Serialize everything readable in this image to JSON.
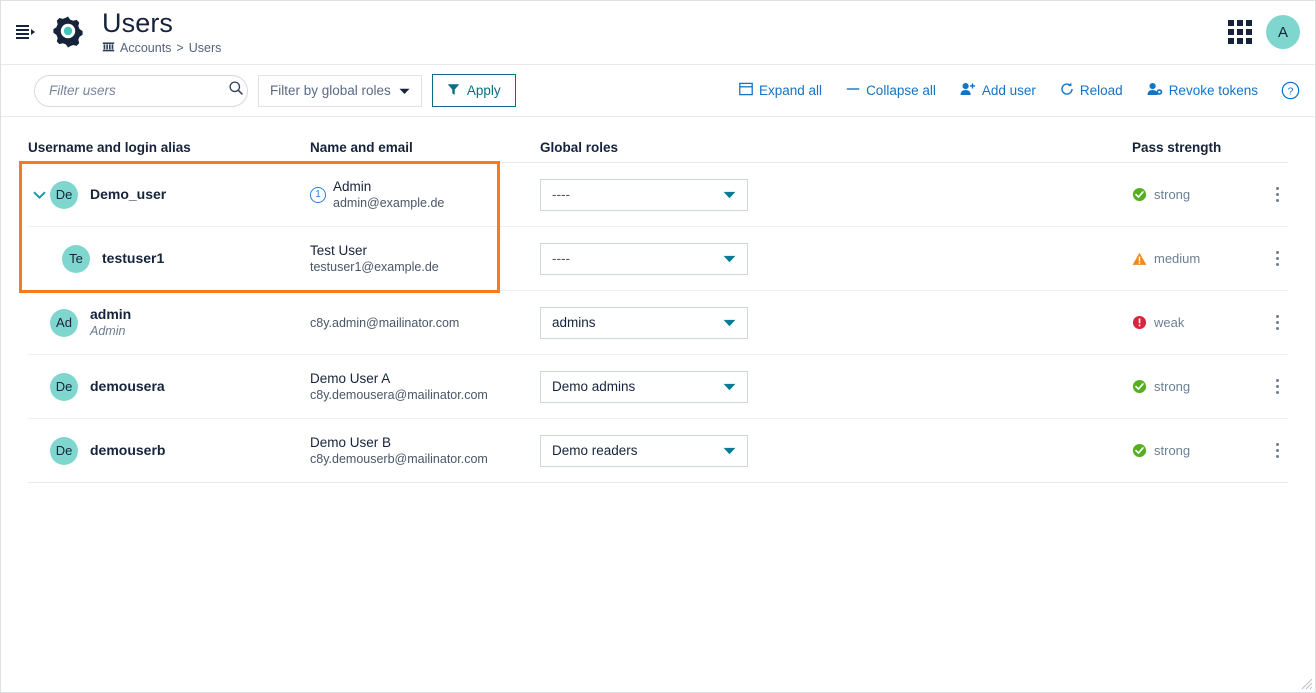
{
  "header": {
    "menu_icon": "hamburger-icon",
    "app_icon": "gear-icon",
    "title": "Users",
    "breadcrumb": {
      "icon": "bank-icon",
      "root": "Accounts",
      "separator": ">",
      "current": "Users"
    },
    "apps_icon": "app-grid-icon",
    "avatar_initial": "A"
  },
  "toolbar": {
    "search_placeholder": "Filter users",
    "search_value": "",
    "search_icon": "search-icon",
    "roles_filter_label": "Filter by global roles",
    "apply_label": "Apply",
    "actions": [
      {
        "label": "Expand all",
        "icon": "expand-all-icon"
      },
      {
        "label": "Collapse all",
        "icon": "collapse-all-icon"
      },
      {
        "label": "Add user",
        "icon": "add-user-icon"
      },
      {
        "label": "Reload",
        "icon": "reload-icon"
      },
      {
        "label": "Revoke tokens",
        "icon": "revoke-tokens-icon"
      }
    ],
    "help_icon": "help-icon"
  },
  "table": {
    "columns": [
      "Username and login alias",
      "Name and email",
      "Global roles",
      "Pass strength"
    ],
    "rows": [
      {
        "expandable": true,
        "avatar": "De",
        "username": "Demo_user",
        "alias": "",
        "badge": "1",
        "fullname": "Admin",
        "email": "admin@example.de",
        "role": "----",
        "role_empty": true,
        "pass": "strong",
        "pass_kind": "strong",
        "highlighted": true
      },
      {
        "expandable": false,
        "indented": true,
        "avatar": "Te",
        "username": "testuser1",
        "alias": "",
        "badge": "",
        "fullname": "Test User",
        "email": "testuser1@example.de",
        "role": "----",
        "role_empty": true,
        "pass": "medium",
        "pass_kind": "medium",
        "highlighted": true
      },
      {
        "expandable": false,
        "avatar": "Ad",
        "username": "admin",
        "alias": "Admin",
        "badge": "",
        "fullname": "",
        "email": "c8y.admin@mailinator.com",
        "role": "admins",
        "role_empty": false,
        "pass": "weak",
        "pass_kind": "weak",
        "highlighted": false
      },
      {
        "expandable": false,
        "avatar": "De",
        "username": "demousera",
        "alias": "",
        "badge": "",
        "fullname": "Demo User A",
        "email": "c8y.demousera@mailinator.com",
        "role": "Demo admins",
        "role_empty": false,
        "pass": "strong",
        "pass_kind": "strong",
        "highlighted": false
      },
      {
        "expandable": false,
        "avatar": "De",
        "username": "demouserb",
        "alias": "",
        "badge": "",
        "fullname": "Demo User B",
        "email": "c8y.demouserb@mailinator.com",
        "role": "Demo readers",
        "role_empty": false,
        "pass": "strong",
        "pass_kind": "strong",
        "highlighted": false
      }
    ]
  },
  "colors": {
    "accent_teal": "#7fd6ce",
    "navy": "#16233a",
    "link_blue": "#1573c6",
    "apply_teal": "#0b6e84",
    "highlight_orange": "#f47b20",
    "strong_green": "#54b022",
    "medium_orange": "#f08a1c",
    "weak_red": "#d9253f"
  }
}
